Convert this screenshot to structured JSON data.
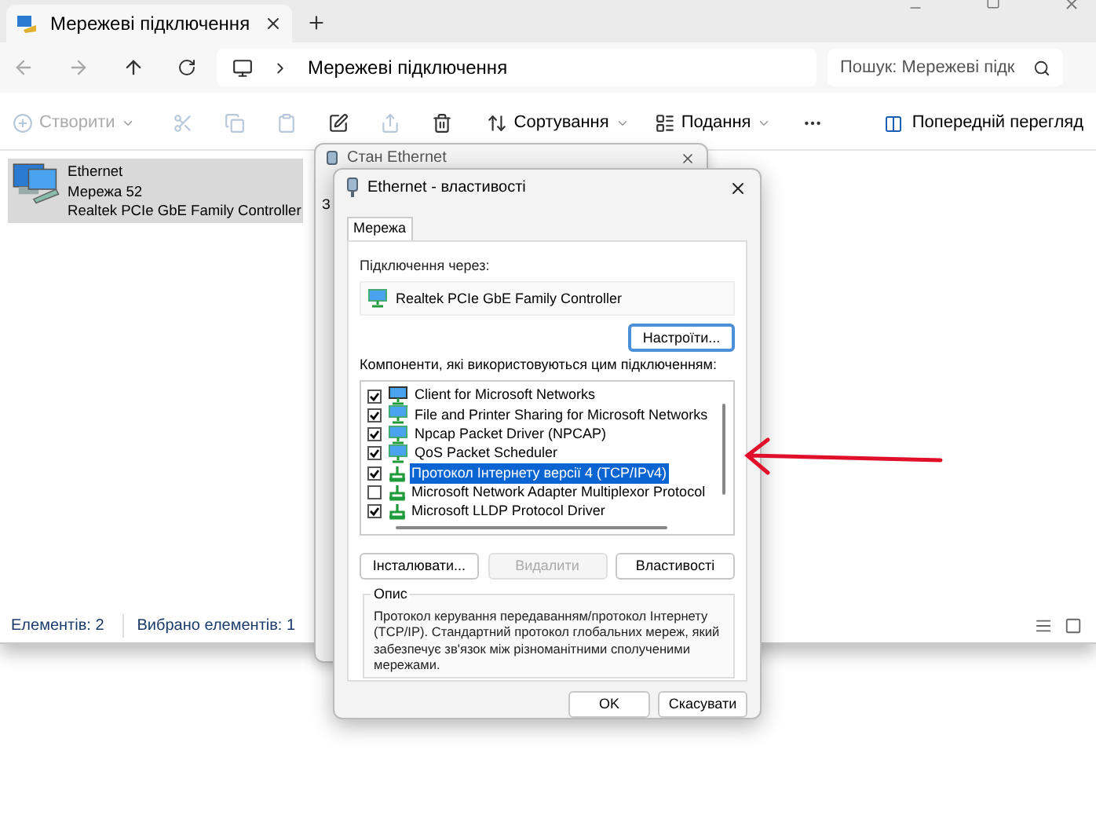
{
  "explorer": {
    "tab_title": "Мережеві підключення",
    "address": "Мережеві підключення",
    "search": {
      "placeholder": "Пошук: Мережеві підк"
    },
    "toolbar": [
      {
        "kind": "new",
        "label": "Створити",
        "disabled": true
      },
      {
        "kind": "cut",
        "disabled": true
      },
      {
        "kind": "copy",
        "disabled": true
      },
      {
        "kind": "paste",
        "disabled": true
      },
      {
        "kind": "rename",
        "disabled": false
      },
      {
        "kind": "share",
        "disabled": true
      },
      {
        "kind": "delete",
        "disabled": false
      },
      {
        "kind": "sort",
        "label": "Сортування",
        "disabled": false
      },
      {
        "kind": "view",
        "label": "Подання",
        "disabled": false
      },
      {
        "kind": "more",
        "disabled": false
      }
    ],
    "preview": "Попередній перегляд",
    "items": [
      {
        "name": "Ethernet",
        "network": "Мережа 52",
        "adapter": "Realtek PCIe GbE Family Controller",
        "selected": true
      }
    ],
    "status_bar": [
      "Елементів: 2",
      "Вибрано елементів: 1"
    ]
  },
  "status_dialog": {
    "title": "Стан Ethernet",
    "tab_fragment": "З"
  },
  "properties_dialog": {
    "title": "Ethernet - властивості",
    "tabs": [
      {
        "label": "Мережа",
        "selected": true
      }
    ],
    "connect_using_label": "Підключення через:",
    "adapter": "Realtek PCIe GbE Family Controller",
    "configure_button": "Настроїти...",
    "components_label": "Компоненти, які використовуються цим підключенням:",
    "components": [
      {
        "kind": "client",
        "label": "Client for Microsoft Networks",
        "checked": true,
        "selected": false
      },
      {
        "kind": "service",
        "label": "File and Printer Sharing for Microsoft Networks",
        "checked": true,
        "selected": false
      },
      {
        "kind": "service",
        "label": "Npcap Packet Driver (NPCAP)",
        "checked": true,
        "selected": false
      },
      {
        "kind": "service",
        "label": "QoS Packet Scheduler",
        "checked": true,
        "selected": false
      },
      {
        "kind": "protocol",
        "label": "Протокол Інтернету версії 4 (TCP/IPv4)",
        "checked": true,
        "selected": true
      },
      {
        "kind": "protocol",
        "label": "Microsoft Network Adapter Multiplexor Protocol",
        "checked": false,
        "selected": false
      },
      {
        "kind": "protocol",
        "label": "Microsoft LLDP Protocol Driver",
        "checked": true,
        "selected": false
      }
    ],
    "buttons": [
      {
        "label": "Інсталювати...",
        "disabled": false
      },
      {
        "label": "Видалити",
        "disabled": true
      },
      {
        "label": "Властивості",
        "disabled": false
      }
    ],
    "description": {
      "title": "Опис",
      "text": "Протокол керування передаванням/протокол Інтернету (TCP/IP). Стандартний протокол глобальних мереж, який забезпечує зв'язок між різноманітними сполученими мережами."
    },
    "footer_buttons": [
      "OK",
      "Скасувати"
    ]
  }
}
